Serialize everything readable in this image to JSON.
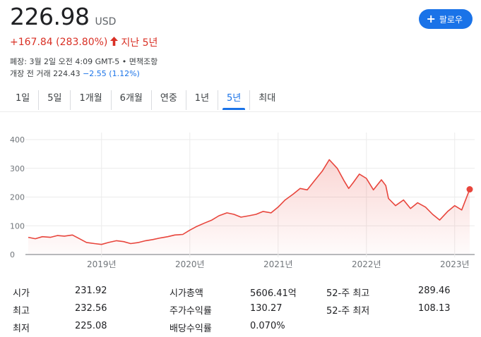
{
  "quote": {
    "price": "226.98",
    "currency": "USD",
    "change": "+167.84 (283.80%)",
    "change_period": "지난 5년",
    "meta": "폐장: 3월 2일 오전 4:09 GMT-5 • 면책조항",
    "premarket_label": "개장 전 거래 224.43",
    "premarket_change": "−2.55 (1.12%)"
  },
  "follow_button": {
    "label": "팔로우"
  },
  "tabs": [
    "1일",
    "5일",
    "1개월",
    "6개월",
    "연중",
    "1년",
    "5년",
    "최대"
  ],
  "active_tab": "5년",
  "colors": {
    "accent": "#1a73e8",
    "negative": "#d93025",
    "line": "#e8453c"
  },
  "chart_data": {
    "type": "area",
    "x_ticks": [
      "2019년",
      "2020년",
      "2021년",
      "2022년",
      "2023년"
    ],
    "y_ticks": [
      "0",
      "100",
      "200",
      "300",
      "400"
    ],
    "ylim": [
      0,
      400
    ],
    "xlim": [
      2018.17,
      2023.17
    ],
    "grid": true,
    "series": [
      {
        "x": [
          2018.17,
          2018.25,
          2018.33,
          2018.42,
          2018.5,
          2018.58,
          2018.67,
          2018.75,
          2018.83,
          2018.92,
          2019.0,
          2019.08,
          2019.17,
          2019.25,
          2019.33,
          2019.42,
          2019.5,
          2019.58,
          2019.67,
          2019.75,
          2019.83,
          2019.92,
          2020.0,
          2020.08,
          2020.17,
          2020.25,
          2020.33,
          2020.42,
          2020.5,
          2020.58,
          2020.67,
          2020.75,
          2020.83,
          2020.92,
          2021.0,
          2021.08,
          2021.17,
          2021.25,
          2021.33,
          2021.42,
          2021.5,
          2021.58,
          2021.67,
          2021.75,
          2021.8,
          2021.85,
          2021.92,
          2022.0,
          2022.08,
          2022.17,
          2022.22,
          2022.25,
          2022.33,
          2022.42,
          2022.5,
          2022.58,
          2022.67,
          2022.75,
          2022.83,
          2022.92,
          2023.0,
          2023.08,
          2023.17
        ],
        "y": [
          60,
          55,
          62,
          60,
          66,
          64,
          68,
          55,
          42,
          38,
          35,
          42,
          48,
          45,
          38,
          42,
          48,
          52,
          58,
          62,
          68,
          70,
          85,
          98,
          110,
          120,
          135,
          145,
          140,
          130,
          135,
          140,
          150,
          145,
          165,
          190,
          210,
          230,
          225,
          260,
          290,
          330,
          300,
          255,
          230,
          250,
          280,
          265,
          225,
          260,
          240,
          195,
          170,
          190,
          160,
          180,
          165,
          140,
          120,
          150,
          170,
          155,
          226.98
        ]
      }
    ]
  },
  "stats": [
    {
      "label": "시가",
      "value": "231.92"
    },
    {
      "label": "최고",
      "value": "232.56"
    },
    {
      "label": "최저",
      "value": "225.08"
    },
    {
      "label": "시가총액",
      "value": "5606.41억"
    },
    {
      "label": "주가수익률",
      "value": "130.27"
    },
    {
      "label": "배당수익률",
      "value": "0.070%"
    },
    {
      "label": "52-주 최고",
      "value": "289.46"
    },
    {
      "label": "52-주 최저",
      "value": "108.13"
    }
  ]
}
